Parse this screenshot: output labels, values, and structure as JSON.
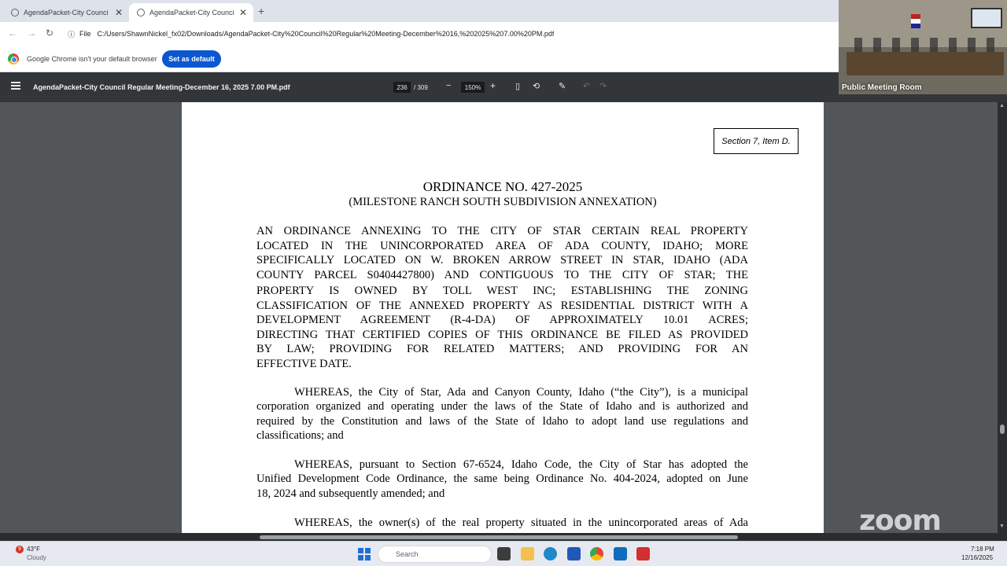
{
  "tabs": [
    {
      "label": "AgendaPacket-City Council Re",
      "active": false
    },
    {
      "label": "AgendaPacket-City Council Re",
      "active": true
    }
  ],
  "address": {
    "chip": "File",
    "url": "C:/Users/ShawnNickel_fx02/Downloads/AgendaPacket-City%20Council%20Regular%20Meeting-December%2016,%202025%207.00%20PM.pdf"
  },
  "infobar": {
    "message": "Google Chrome isn't your default browser",
    "button": "Set as default"
  },
  "pdf_toolbar": {
    "title": "AgendaPacket-City Council Regular Meeting-December 16, 2025 7.00 PM.pdf",
    "current_page": "236",
    "total_pages": "/ 309",
    "zoom": "150%"
  },
  "zoom_inset": {
    "label": "Public Meeting Room"
  },
  "document": {
    "section_label": "Section 7, Item D.",
    "title": "ORDINANCE NO. 427-2025",
    "subtitle": "(MILESTONE RANCH SOUTH SUBDIVISION ANNEXATION)",
    "caps_lines": [
      "AN ORDINANCE ANNEXING TO THE CITY OF STAR CERTAIN REAL PROPERTY",
      "LOCATED IN THE UNINCORPORATED AREA OF ADA COUNTY, IDAHO; MORE",
      "SPECIFICALLY LOCATED ON W. BROKEN ARROW STREET IN STAR, IDAHO (ADA",
      "COUNTY PARCEL S0404427800) AND CONTIGUOUS TO THE CITY OF STAR; THE",
      "PROPERTY IS OWNED BY TOLL WEST INC; ESTABLISHING THE ZONING",
      "CLASSIFICATION OF THE ANNEXED PROPERTY AS RESIDENTIAL DISTRICT WITH A",
      "DEVELOPMENT AGREEMENT (R-4-DA) OF APPROXIMATELY 10.01 ACRES;",
      "DIRECTING THAT CERTIFIED COPIES OF THIS ORDINANCE BE FILED AS PROVIDED",
      "BY LAW; PROVIDING FOR RELATED MATTERS; AND PROVIDING FOR AN",
      "EFFECTIVE DATE."
    ],
    "para1": [
      "WHEREAS, the City of Star, Ada and Canyon County, Idaho (“the City”), is a municipal",
      "corporation organized and operating under the laws of the State of Idaho and is authorized and",
      "required by the Constitution and laws of the State of Idaho to adopt land use regulations and",
      "classifications; and"
    ],
    "para2": [
      "WHEREAS, pursuant to Section 67-6524, Idaho Code, the City of Star has adopted the",
      "Unified Development Code Ordinance, the same being Ordinance No. 404-2024, adopted on June",
      "18, 2024 and subsequently amended; and"
    ],
    "para3": [
      "WHEREAS, the owner(s) of the real property situated in the unincorporated areas of Ada"
    ]
  },
  "watermark": "zoom",
  "taskbar": {
    "weather_temp": "43°F",
    "weather_cond": "Cloudy",
    "weather_badge": "9",
    "search_placeholder": "Search",
    "time": "7:18 PM",
    "date": "12/16/2025"
  },
  "colors": {
    "accent": "#0b57d0",
    "pdf_toolbar": "#323639",
    "viewer_bg": "#525659"
  }
}
